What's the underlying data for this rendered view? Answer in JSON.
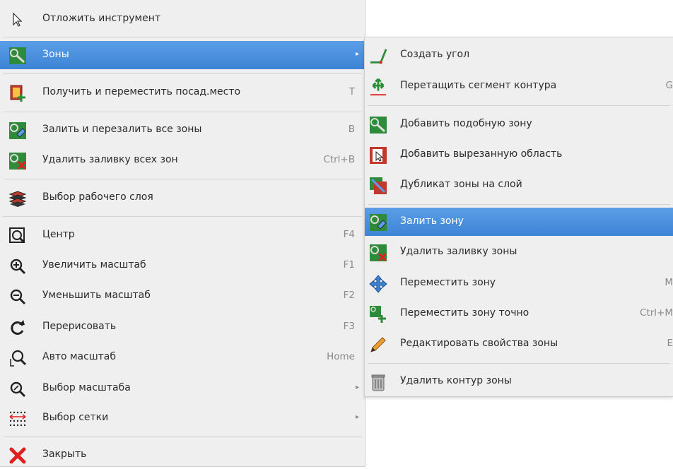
{
  "main_menu": {
    "items": [
      {
        "label": "Отложить инструмент",
        "shortcut": "",
        "icon": "cursor-arrow-icon"
      },
      {
        "label": "Зоны",
        "shortcut": "",
        "icon": "zone-icon",
        "submenu": true,
        "selected": true
      },
      {
        "label": "Получить и переместить посад.место",
        "shortcut": "T",
        "icon": "footprint-move-icon"
      },
      {
        "label": "Залить и перезалить все зоны",
        "shortcut": "B",
        "icon": "zone-fill-icon"
      },
      {
        "label": "Удалить заливку всех зон",
        "shortcut": "Ctrl+B",
        "icon": "zone-unfill-icon"
      },
      {
        "label": "Выбор рабочего слоя",
        "shortcut": "",
        "icon": "layers-icon"
      },
      {
        "label": "Центр",
        "shortcut": "F4",
        "icon": "zoom-center-icon"
      },
      {
        "label": "Увеличить масштаб",
        "shortcut": "F1",
        "icon": "zoom-in-icon"
      },
      {
        "label": "Уменьшить масштаб",
        "shortcut": "F2",
        "icon": "zoom-out-icon"
      },
      {
        "label": "Перерисовать",
        "shortcut": "F3",
        "icon": "redraw-icon"
      },
      {
        "label": "Авто масштаб",
        "shortcut": "Home",
        "icon": "zoom-fit-icon"
      },
      {
        "label": "Выбор масштаба",
        "shortcut": "",
        "icon": "zoom-select-icon",
        "submenu": true
      },
      {
        "label": "Выбор сетки",
        "shortcut": "",
        "icon": "grid-icon",
        "submenu": true
      },
      {
        "label": "Закрыть",
        "shortcut": "",
        "icon": "close-icon"
      }
    ]
  },
  "sub_menu": {
    "items": [
      {
        "label": "Создать угол",
        "shortcut": "",
        "icon": "create-corner-icon"
      },
      {
        "label": "Перетащить сегмент контура",
        "shortcut": "G",
        "icon": "drag-segment-icon"
      },
      {
        "label": "Добавить подобную зону",
        "shortcut": "",
        "icon": "add-similar-zone-icon"
      },
      {
        "label": "Добавить вырезанную область",
        "shortcut": "",
        "icon": "add-cutout-icon"
      },
      {
        "label": "Дубликат зоны на слой",
        "shortcut": "",
        "icon": "duplicate-zone-icon"
      },
      {
        "label": "Залить зону",
        "shortcut": "",
        "icon": "fill-zone-icon",
        "selected": true
      },
      {
        "label": "Удалить заливку зоны",
        "shortcut": "",
        "icon": "unfill-zone-icon"
      },
      {
        "label": "Переместить зону",
        "shortcut": "M",
        "icon": "move-icon"
      },
      {
        "label": "Переместить зону точно",
        "shortcut": "Ctrl+M",
        "icon": "move-exact-icon"
      },
      {
        "label": "Редактировать свойства зоны",
        "shortcut": "E",
        "icon": "pencil-icon"
      },
      {
        "label": "Удалить контур зоны",
        "shortcut": "",
        "icon": "trash-icon"
      }
    ]
  },
  "colors": {
    "highlight": "#4a90e2",
    "menu_bg": "#efefef",
    "zone_green": "#2e8b3a",
    "delete_red": "#e02020"
  }
}
